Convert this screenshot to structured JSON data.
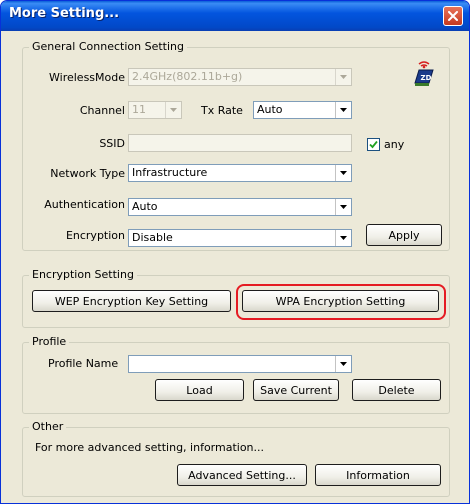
{
  "window": {
    "title": "More Setting...",
    "close_icon": "close-icon"
  },
  "general": {
    "legend": "General Connection Setting",
    "wireless_mode_label": "WirelessMode",
    "wireless_mode_value": "2.4GHz(802.11b+g)",
    "channel_label": "Channel",
    "channel_value": "11",
    "tx_rate_label": "Tx Rate",
    "tx_rate_value": "Auto",
    "ssid_label": "SSID",
    "ssid_value": "",
    "any_label": "any",
    "any_checked": true,
    "network_type_label": "Network Type",
    "network_type_value": "Infrastructure",
    "authentication_label": "Authentication",
    "authentication_value": "Auto",
    "encryption_label": "Encryption",
    "encryption_value": "Disable",
    "apply_label": "Apply",
    "logo_text": "ZD"
  },
  "encryption_setting": {
    "legend": "Encryption Setting",
    "wep_label": "WEP Encryption Key Setting",
    "wpa_label": "WPA Encryption Setting",
    "highlight_color": "#e51c23"
  },
  "profile": {
    "legend": "Profile",
    "profile_name_label": "Profile Name",
    "profile_name_value": "",
    "load_label": "Load",
    "save_label": "Save Current",
    "delete_label": "Delete"
  },
  "other": {
    "legend": "Other",
    "description": "For more advanced setting, information...",
    "advanced_label": "Advanced Setting...",
    "information_label": "Information"
  },
  "colors": {
    "title_bar": "#0355df",
    "dialog_bg": "#ece9d8",
    "close_button": "#c5391f"
  }
}
